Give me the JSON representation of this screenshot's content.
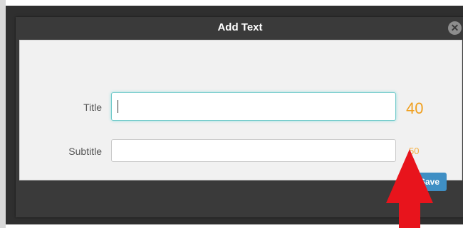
{
  "dialog": {
    "title": "Add Text",
    "close_symbol": "✕",
    "save_label": "Save"
  },
  "fields": {
    "title": {
      "label": "Title",
      "value": "",
      "counter": "40"
    },
    "subtitle": {
      "label": "Subtitle",
      "value": "",
      "counter": "50"
    }
  },
  "annotation": {
    "icon": "red-arrow-up-icon",
    "color": "#e8141c"
  },
  "colors": {
    "counter": "#f0a020",
    "focus": "#6fc9c9",
    "save": "#3f8fc4"
  }
}
